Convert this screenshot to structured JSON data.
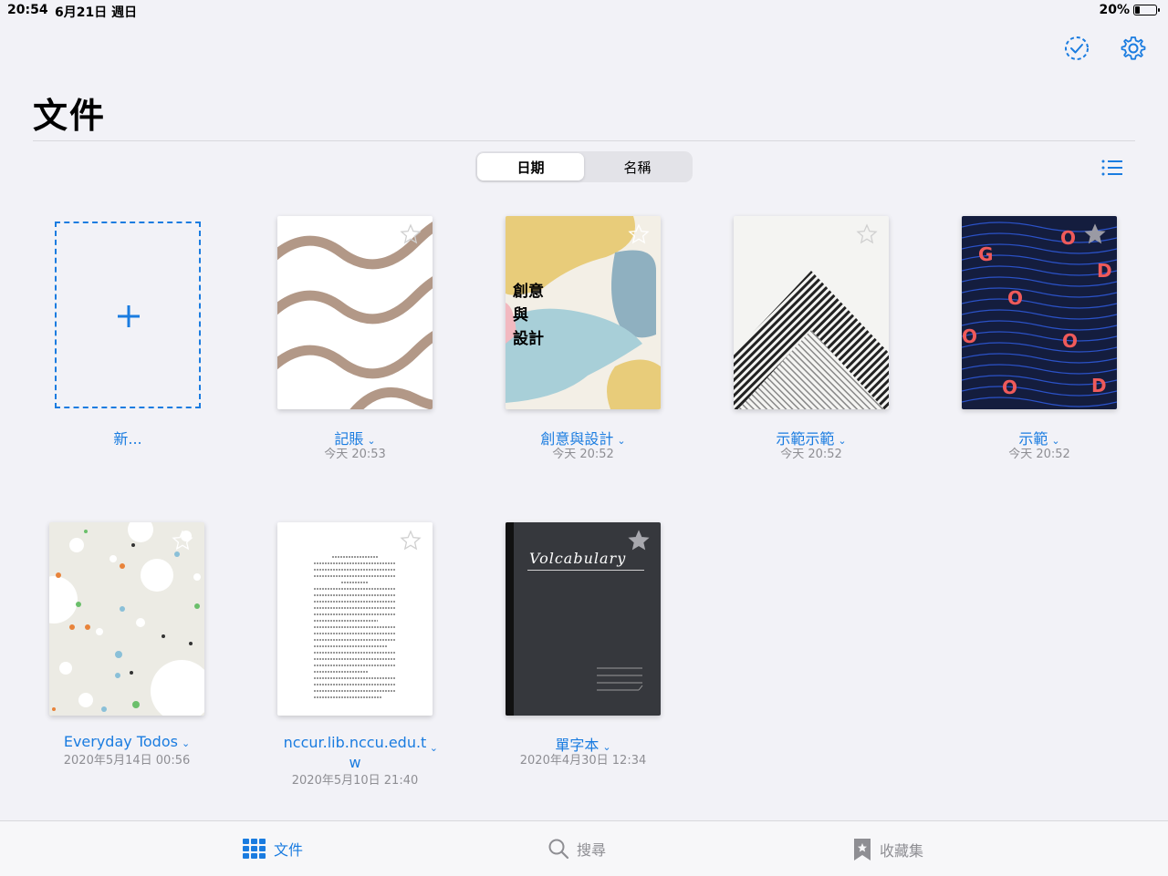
{
  "status": {
    "time": "20:54",
    "date": "6月21日 週日",
    "battery": "20%"
  },
  "page_title": "文件",
  "sort": {
    "options": [
      "日期",
      "名稱"
    ],
    "selected": "日期"
  },
  "new_label": "新...",
  "documents": [
    {
      "name": "記賬",
      "time": "今天 20:53"
    },
    {
      "name": "創意與設計",
      "time": "今天 20:52",
      "cover_text": [
        "創意",
        "與",
        "設計"
      ]
    },
    {
      "name": "示範示範",
      "time": "今天 20:52"
    },
    {
      "name": "示範",
      "time": "今天 20:52",
      "cover_text": [
        "G",
        "O",
        "O",
        "D",
        "O",
        "O",
        "O",
        "D"
      ]
    },
    {
      "name": "Everyday Todos",
      "time": "2020年5月14日 00:56"
    },
    {
      "name_line1": "nccur.lib.nccu.edu.t",
      "name_line2": "w",
      "time": "2020年5月10日 21:40"
    },
    {
      "name": "單字本",
      "time": "2020年4月30日 12:34",
      "cover_text": "Volcabulary"
    }
  ],
  "tabs": [
    {
      "label": "文件",
      "icon": "grid-icon",
      "active": true
    },
    {
      "label": "搜尋",
      "icon": "search-icon",
      "active": false
    },
    {
      "label": "收藏集",
      "icon": "bookmark-icon",
      "active": false
    }
  ],
  "colors": {
    "accent": "#1a7ce0",
    "background": "#f2f2f7"
  }
}
